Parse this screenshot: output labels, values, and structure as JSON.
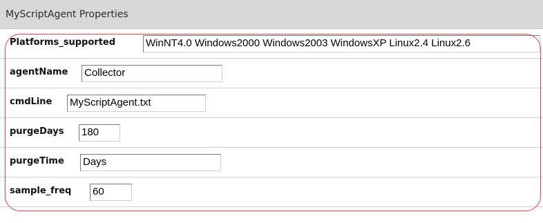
{
  "panel": {
    "title": "MyScriptAgent Properties"
  },
  "properties": [
    {
      "label": "Platforms_supported",
      "value": "WinNT4.0 Windows2000 Windows2003 WindowsXP Linux2.4 Linux2.6"
    },
    {
      "label": "agentName",
      "value": "Collector"
    },
    {
      "label": "cmdLine",
      "value": "MyScriptAgent.txt"
    },
    {
      "label": "purgeDays",
      "value": "180"
    },
    {
      "label": "purgeTime",
      "value": "Days"
    },
    {
      "label": "sample_freq",
      "value": "60"
    }
  ],
  "colors": {
    "header_background": "#d8d8d8",
    "highlight_outline": "#e0424e",
    "row_divider": "#d2d2d2"
  }
}
